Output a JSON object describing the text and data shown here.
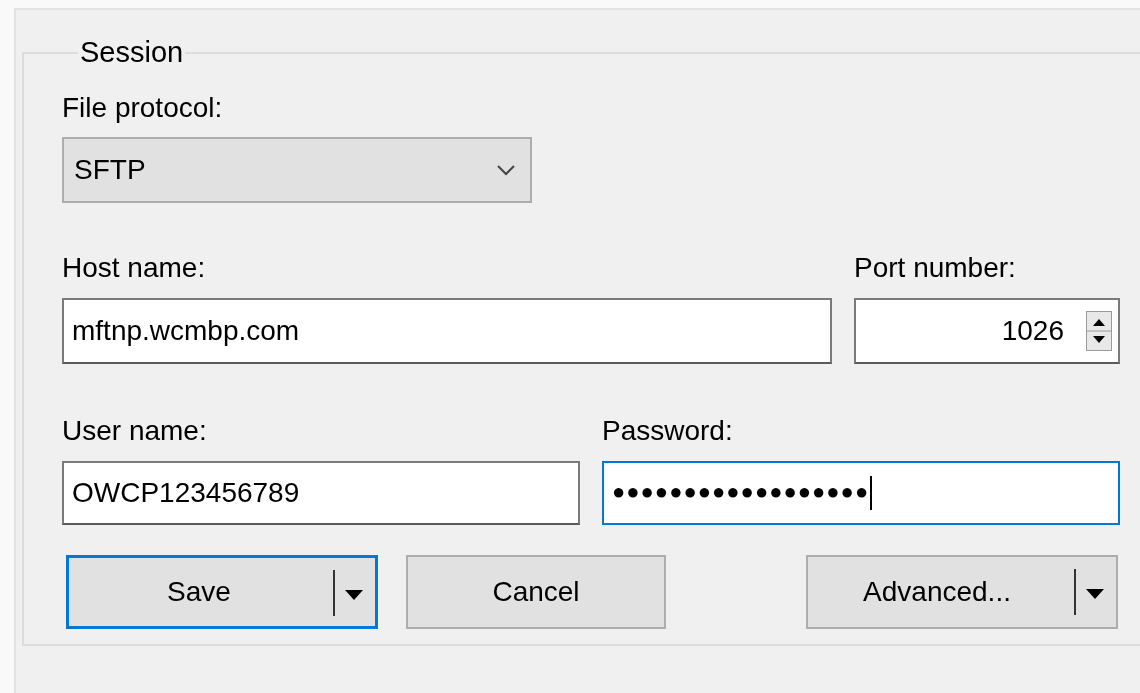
{
  "session": {
    "legend": "Session",
    "file_protocol": {
      "label": "File protocol:",
      "value": "SFTP"
    },
    "host": {
      "label": "Host name:",
      "value": "mftnp.wcmbp.com",
      "focused": false
    },
    "port": {
      "label": "Port number:",
      "value": "1026"
    },
    "user": {
      "label": "User name:",
      "value": "OWCP123456789",
      "focused": false
    },
    "password": {
      "label": "Password:",
      "value": "●●●●●●●●●●●●●●●●●●",
      "focused": true
    },
    "buttons": [
      {
        "label": "Save",
        "kind": "split",
        "default": true
      },
      {
        "label": "Cancel",
        "kind": "plain",
        "default": false
      },
      {
        "label": "Advanced...",
        "kind": "split",
        "default": false
      }
    ]
  }
}
